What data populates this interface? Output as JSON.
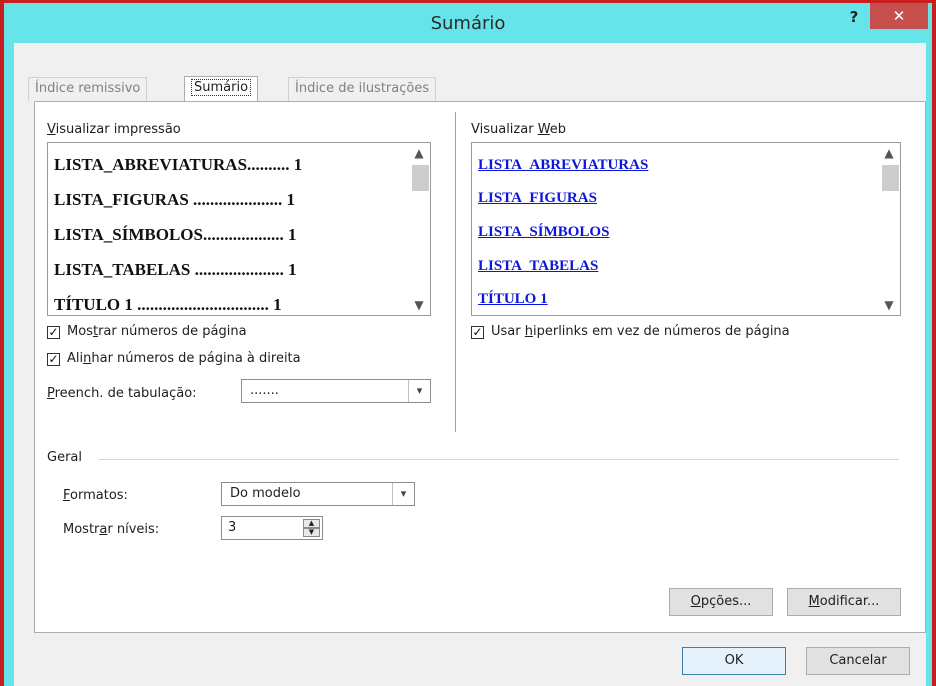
{
  "window": {
    "title": "Sumário",
    "help": "?",
    "close": "✕"
  },
  "tabs": [
    {
      "label": "Índice remissivo"
    },
    {
      "label": "Sumário"
    },
    {
      "label": "Índice de ilustrações"
    }
  ],
  "print_preview": {
    "label_prefix": "",
    "label_u": "V",
    "label_rest": "isualizar impressão",
    "entries": [
      "LISTA_ABREVIATURAS.......... 1",
      "LISTA_FIGURAS ..................... 1",
      "LISTA_SÍMBOLOS................... 1",
      "LISTA_TABELAS ..................... 1",
      "TÍTULO 1 ............................... 1"
    ]
  },
  "web_preview": {
    "label_prefix": "Visualizar ",
    "label_u": "W",
    "label_rest": "eb",
    "entries": [
      "LISTA_ABREVIATURAS",
      "LISTA_FIGURAS",
      "LISTA_SÍMBOLOS",
      "LISTA_TABELAS",
      "TÍTULO 1"
    ]
  },
  "options": {
    "show_page_numbers": {
      "p1": "Mos",
      "u": "t",
      "p2": "rar números de página",
      "checked": true
    },
    "right_align": {
      "p1": "Ali",
      "u": "n",
      "p2": "har números de página à direita",
      "checked": true
    },
    "use_hyperlinks": {
      "p1": "Usar ",
      "u": "h",
      "p2": "iperlinks em vez de números de página",
      "checked": true
    },
    "tab_leader": {
      "u": "P",
      "p2": "reench. de tabulação:",
      "value": "......."
    }
  },
  "general": {
    "heading": "Geral",
    "formats": {
      "u": "F",
      "p2": "ormatos:",
      "value": "Do modelo"
    },
    "levels": {
      "p1": "Mostr",
      "u": "a",
      "p2": "r níveis:",
      "value": "3"
    }
  },
  "buttons": {
    "options": {
      "u": "O",
      "p2": "pções..."
    },
    "modify": {
      "u": "M",
      "p2": "odificar..."
    },
    "ok": "OK",
    "cancel": "Cancelar"
  },
  "colors": {
    "titlebar": "#66e4ea",
    "close": "#c7504f",
    "hyperlink": "#0b16d9",
    "frame": "#c81e1e"
  }
}
